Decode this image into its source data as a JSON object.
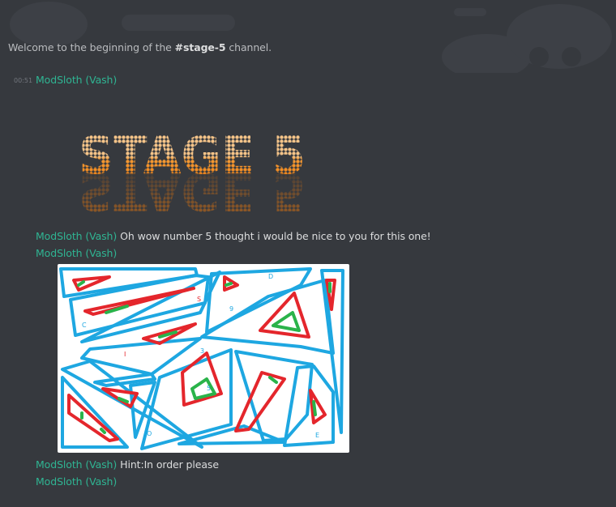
{
  "channel": {
    "welcome_prefix": "Welcome to the beginning of the ",
    "channel_name": "#stage-5",
    "welcome_suffix": " channel."
  },
  "messages": [
    {
      "timestamp": "00:51",
      "author": "ModSloth (Vash)",
      "text": ""
    },
    {
      "author": "ModSloth (Vash)",
      "text": "Oh wow number 5 thought i would be nice to you for this one!"
    },
    {
      "author": "ModSloth (Vash)",
      "text": ""
    },
    {
      "author": "ModSloth (Vash)",
      "text": "Hint:In order please"
    },
    {
      "author": "ModSloth (Vash)",
      "text": ""
    }
  ],
  "stage_banner": {
    "text": "STAGE 5"
  },
  "puzzle_letters": [
    "S",
    "9",
    "D",
    "C",
    "I",
    "3",
    "5",
    "O",
    "E"
  ],
  "colors": {
    "background": "#36393e",
    "author": "#2fb593",
    "banner_top": "#f5c489",
    "banner_bottom": "#f07d10",
    "puzzle_blue": "#1ea7e1",
    "puzzle_red": "#e4262c",
    "puzzle_green": "#2ab34a"
  }
}
